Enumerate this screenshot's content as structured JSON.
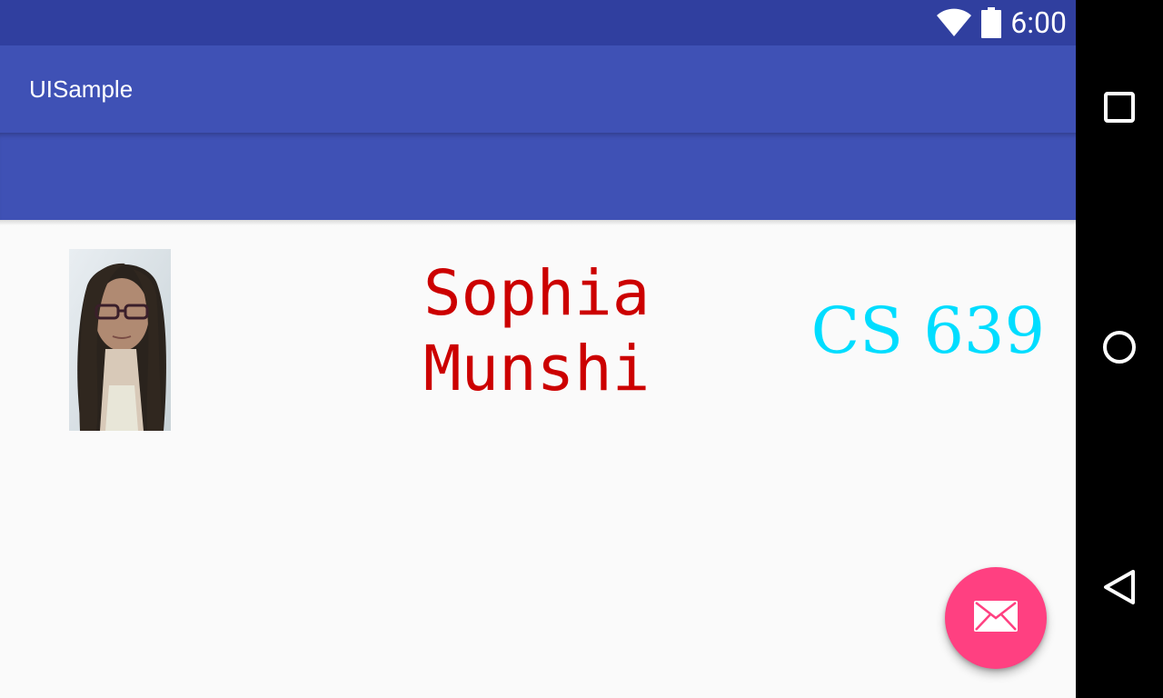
{
  "status_bar": {
    "time": "6:00"
  },
  "app_bar": {
    "title": "UISample"
  },
  "profile": {
    "name": "Sophia\nMunshi",
    "course": "CS 639",
    "photo_alt": "profile photo"
  },
  "fab": {
    "icon": "mail-icon"
  },
  "nav": {
    "recent_icon": "square-icon",
    "home_icon": "circle-icon",
    "back_icon": "triangle-back-icon"
  },
  "colors": {
    "status_bar": "#303f9f",
    "primary": "#3f51b5",
    "accent": "#ff4081",
    "name_text": "#cc0000",
    "course_text": "#00ddff",
    "background": "#fafafa"
  }
}
